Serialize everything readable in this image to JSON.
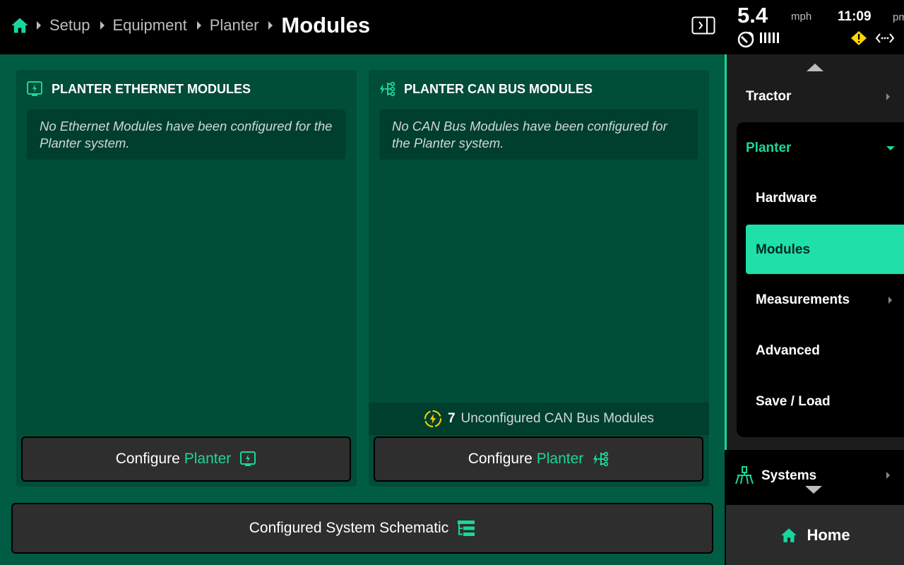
{
  "breadcrumb": {
    "items": [
      "Setup",
      "Equipment",
      "Planter"
    ],
    "current": "Modules"
  },
  "status": {
    "speed": "5.4",
    "speed_unit": "mph",
    "time": "11:09",
    "ampm": "pm"
  },
  "panels": {
    "ethernet": {
      "title": "PLANTER ETHERNET MODULES",
      "empty_message": "No Ethernet Modules have been configured for the Planter system.",
      "button_prefix": "Configure",
      "button_accent": "Planter"
    },
    "canbus": {
      "title": "PLANTER CAN BUS MODULES",
      "empty_message": "No CAN Bus Modules have been configured for the Planter system.",
      "unconfigured_count": "7",
      "unconfigured_label": "Unconfigured CAN Bus Modules",
      "button_prefix": "Configure",
      "button_accent": "Planter"
    }
  },
  "schematic_button": "Configured System Schematic",
  "nav": {
    "tractor": "Tractor",
    "planter": "Planter",
    "sub_items": [
      "Hardware",
      "Modules",
      "Measurements",
      "Advanced",
      "Save / Load"
    ],
    "systems": "Systems",
    "home": "Home"
  },
  "colors": {
    "accent": "#19d79b",
    "selected": "#1ee0a8",
    "main_bg": "#005d43",
    "card_bg": "#004d38",
    "warning": "#ffd600"
  }
}
